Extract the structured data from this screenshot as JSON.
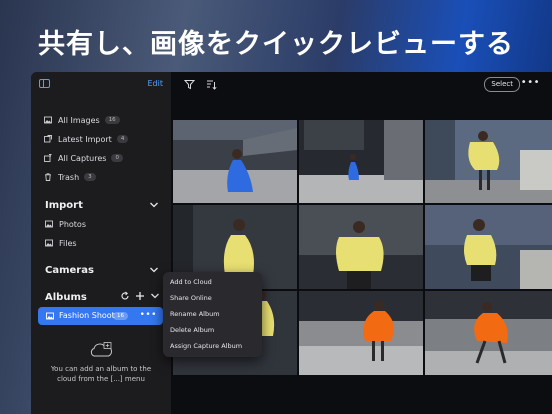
{
  "hero_title": "共有し、画像をクイックレビューする",
  "sidebar": {
    "edit_label": "Edit",
    "library": [
      {
        "label": "All Images",
        "count": "16",
        "icon": "photo-icon"
      },
      {
        "label": "Latest Import",
        "count": "4",
        "icon": "import-icon"
      },
      {
        "label": "All Captures",
        "count": "0",
        "icon": "capture-icon"
      },
      {
        "label": "Trash",
        "count": "3",
        "icon": "trash-icon"
      }
    ],
    "import": {
      "title": "Import",
      "items": [
        "Photos",
        "Files"
      ]
    },
    "cameras": {
      "title": "Cameras"
    },
    "albums": {
      "title": "Albums",
      "selected": {
        "label": "Fashion Shoot",
        "count": "16"
      }
    },
    "cloud_hint": "You can add an album to the cloud from the [...] menu"
  },
  "toolbar": {
    "select_label": "Select"
  },
  "context_menu": [
    "Add to Cloud",
    "Share Online",
    "Rename Album",
    "Delete Album",
    "Assign Capture Album"
  ],
  "colors": {
    "accent": "#3477f0",
    "link": "#4ea1ff",
    "dress_blue": "#2f6be0",
    "dress_yellow": "#e8df72",
    "dress_orange": "#f26a12"
  }
}
